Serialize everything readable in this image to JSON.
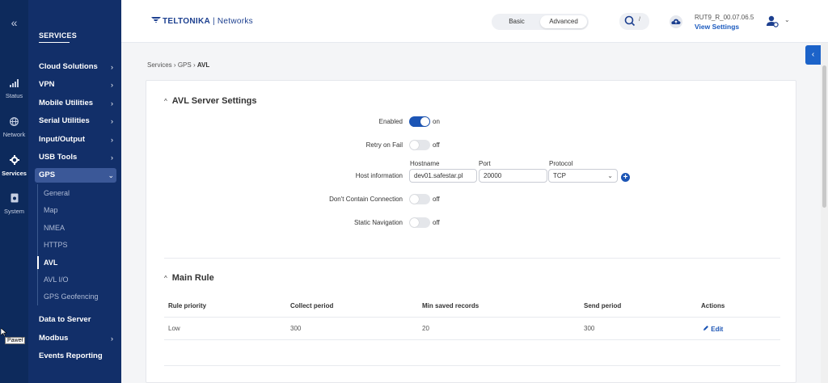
{
  "rail": {
    "collapse_icon": "double-chevron-left-icon",
    "items": [
      {
        "label": "Status",
        "icon": "signal-bars-icon"
      },
      {
        "label": "Network",
        "icon": "globe-icon"
      },
      {
        "label": "Services",
        "icon": "gear-icon"
      },
      {
        "label": "System",
        "icon": "document-gear-icon"
      }
    ]
  },
  "menu": {
    "title": "SERVICES",
    "items": [
      {
        "label": "Cloud Solutions",
        "chevron": "›"
      },
      {
        "label": "VPN",
        "chevron": "›"
      },
      {
        "label": "Mobile Utilities",
        "chevron": "›"
      },
      {
        "label": "Serial Utilities",
        "chevron": "›"
      },
      {
        "label": "Input/Output",
        "chevron": "›"
      },
      {
        "label": "USB Tools",
        "chevron": "›"
      },
      {
        "label": "GPS",
        "chevron": "⌄"
      }
    ],
    "gps_sub": [
      "General",
      "Map",
      "NMEA",
      "HTTPS",
      "AVL",
      "AVL I/O",
      "GPS Geofencing"
    ],
    "bottom_items": [
      {
        "label": "Data to Server",
        "chevron": ""
      },
      {
        "label": "Modbus",
        "chevron": "›"
      },
      {
        "label": "Events Reporting",
        "chevron": ""
      }
    ]
  },
  "header": {
    "logo_brand": "TELTONIKA",
    "logo_sep": "|",
    "logo_product": "Networks",
    "mode_basic": "Basic",
    "mode_advanced": "Advanced",
    "search_kbd": "/",
    "firmware": "RUT9_R_00.07.06.5",
    "view_settings": "View Settings",
    "user_chevron": "⌄",
    "float_tab": "‹"
  },
  "breadcrumb": {
    "items": [
      "Services",
      "GPS",
      "AVL"
    ],
    "sep": "›"
  },
  "avl": {
    "title": "AVL Server Settings",
    "caret": "^",
    "enabled_label": "Enabled",
    "enabled_state": "on",
    "retry_label": "Retry on Fail",
    "retry_state": "off",
    "host_label": "Host information",
    "col_hostname": "Hostname",
    "col_port": "Port",
    "col_protocol": "Protocol",
    "hostname_value": "dev01.safestar.pl",
    "port_value": "20000",
    "protocol_value": "TCP",
    "protocol_chevron": "⌄",
    "add_symbol": "+",
    "dont_contain_label": "Don't Contain Connection",
    "dont_contain_state": "off",
    "static_nav_label": "Static Navigation",
    "static_nav_state": "off"
  },
  "main_rule": {
    "title": "Main Rule",
    "caret": "^",
    "headers": [
      "Rule priority",
      "Collect period",
      "Min saved records",
      "Send period",
      "Actions"
    ],
    "row": [
      "Low",
      "300",
      "20",
      "300"
    ],
    "edit_label": "Edit",
    "edit_icon": "pencil-icon"
  },
  "cursor_tooltip": "Paweł",
  "colors": {
    "rail": "#0d2a5c",
    "menu": "#122f69",
    "accent": "#1c55b5"
  }
}
